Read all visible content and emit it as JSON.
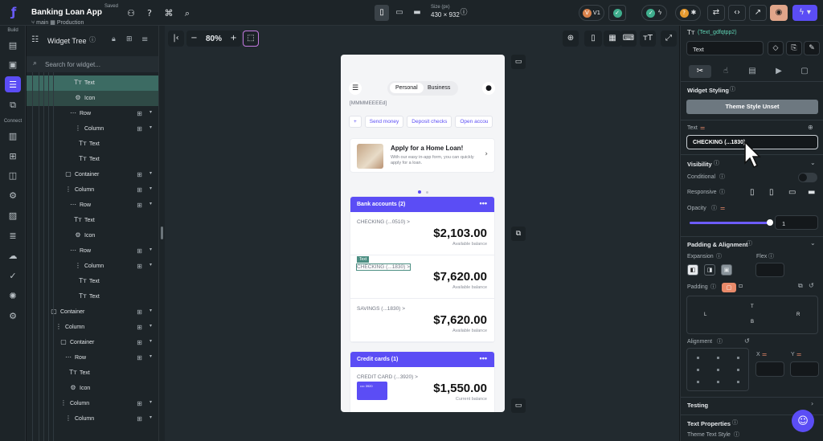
{
  "topbar": {
    "project_name": "Banking Loan App",
    "saved_label": "Saved",
    "branch": "main",
    "environment": "Production",
    "size_label": "Size (px)",
    "size_value": "430 × 932",
    "version_label": "V1"
  },
  "rail": {
    "build_label": "Build",
    "connect_label": "Connect"
  },
  "tree": {
    "title": "Widget Tree",
    "search_placeholder": "Search for widget...",
    "rows": [
      {
        "label": "Text",
        "icon": "text-icon",
        "indent": 92,
        "state": "sel"
      },
      {
        "label": "Icon",
        "icon": "icon-icon",
        "indent": 92,
        "state": "hov"
      },
      {
        "label": "Row",
        "icon": "row-icon",
        "indent": 86,
        "state": ""
      },
      {
        "label": "Column",
        "icon": "column-icon",
        "indent": 92,
        "state": ""
      },
      {
        "label": "Text",
        "icon": "text-icon",
        "indent": 98,
        "state": ""
      },
      {
        "label": "Text",
        "icon": "text-icon",
        "indent": 98,
        "state": ""
      },
      {
        "label": "Container",
        "icon": "container-icon",
        "indent": 80,
        "state": ""
      },
      {
        "label": "Column",
        "icon": "column-icon",
        "indent": 80,
        "state": ""
      },
      {
        "label": "Row",
        "icon": "row-icon",
        "indent": 86,
        "state": ""
      },
      {
        "label": "Text",
        "icon": "text-icon",
        "indent": 92,
        "state": ""
      },
      {
        "label": "Icon",
        "icon": "icon-icon",
        "indent": 92,
        "state": ""
      },
      {
        "label": "Row",
        "icon": "row-icon",
        "indent": 86,
        "state": ""
      },
      {
        "label": "Column",
        "icon": "column-icon",
        "indent": 92,
        "state": ""
      },
      {
        "label": "Text",
        "icon": "text-icon",
        "indent": 98,
        "state": ""
      },
      {
        "label": "Text",
        "icon": "text-icon",
        "indent": 98,
        "state": ""
      },
      {
        "label": "Container",
        "icon": "container-icon",
        "indent": 62,
        "state": ""
      },
      {
        "label": "Column",
        "icon": "column-icon",
        "indent": 68,
        "state": ""
      },
      {
        "label": "Container",
        "icon": "container-icon",
        "indent": 74,
        "state": ""
      },
      {
        "label": "Row",
        "icon": "row-icon",
        "indent": 80,
        "state": ""
      },
      {
        "label": "Text",
        "icon": "text-icon",
        "indent": 86,
        "state": ""
      },
      {
        "label": "Icon",
        "icon": "icon-icon",
        "indent": 86,
        "state": ""
      },
      {
        "label": "Column",
        "icon": "column-icon",
        "indent": 74,
        "state": ""
      },
      {
        "label": "Column",
        "icon": "column-icon",
        "indent": 80,
        "state": ""
      }
    ]
  },
  "canvas": {
    "zoom": "80%"
  },
  "phone": {
    "tab_personal": "Personal",
    "tab_business": "Business",
    "date_text": "[MMMMEEEEd]",
    "chips": [
      "+",
      "Send money",
      "Deposit checks",
      "Open accou"
    ],
    "promo_title": "Apply for a Home Loan!",
    "promo_sub": "With our easy in-app form, you can quickly apply for a loan.",
    "bank_header": "Bank accounts (2)",
    "accounts": [
      {
        "name": "CHECKING (...0510) >",
        "amount": "$2,103.00",
        "sub": "Available balance"
      },
      {
        "name": "CHECKING (...1830) >",
        "amount": "$7,620.00",
        "sub": "Available balance"
      },
      {
        "name": "SAVINGS (...1830) >",
        "amount": "$7,620.00",
        "sub": "Available balance"
      }
    ],
    "selected_tag": "Text",
    "credit_header": "Credit cards (1)",
    "credit_name": "CREDIT CARD (...3920) >",
    "credit_amount": "$1,550.00",
    "credit_sub": "Current balance",
    "card_number": "•••• 3920"
  },
  "panel": {
    "widget_id": "(Text_gdfqtpp2)",
    "widget_type": "Text",
    "widget_styling": "Widget Styling",
    "theme_style": "Theme Style Unset",
    "text_label": "Text",
    "text_value": "CHECKING (...1830)",
    "visibility": "Visibility",
    "conditional": "Conditional",
    "responsive": "Responsive",
    "opacity": "Opacity",
    "opacity_value": "1",
    "opacity_level": 1,
    "padding_alignment": "Padding & Alignment",
    "expansion": "Expansion",
    "flex": "Flex",
    "padding": "Padding",
    "pad_t": "T",
    "pad_b": "B",
    "pad_l": "L",
    "pad_r": "R",
    "alignment": "Alignment",
    "x": "X",
    "y": "Y",
    "testing": "Testing",
    "text_properties": "Text Properties",
    "theme_text_style": "Theme Text Style"
  },
  "colors": {
    "accent": "#5b4df5",
    "selection": "#3c6b63"
  }
}
